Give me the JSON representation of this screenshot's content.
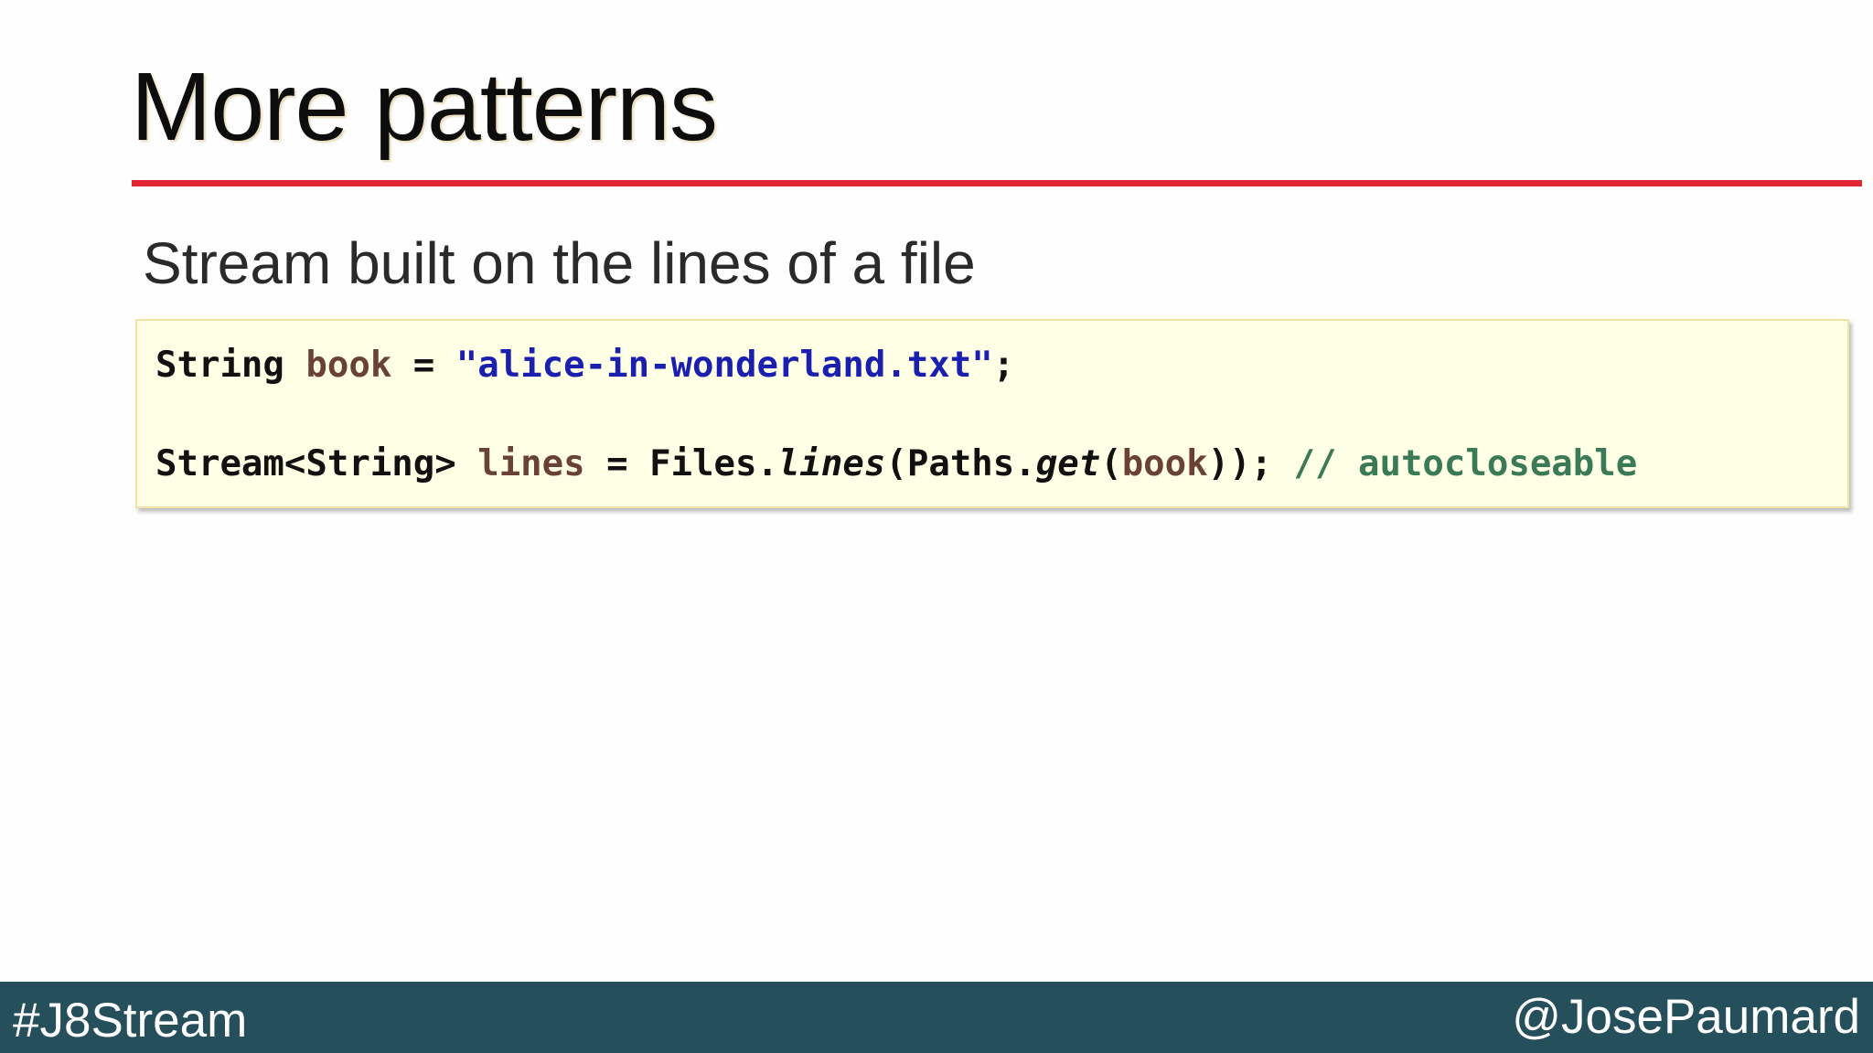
{
  "slide": {
    "title": "More patterns",
    "subtitle": "Stream built on the lines of a file"
  },
  "code": {
    "line1": {
      "type": "String",
      "var": "book",
      "eq": "=",
      "literal": "\"alice-in-wonderland.txt\"",
      "end": ";"
    },
    "line2": {
      "type": "Stream<String>",
      "var": "lines",
      "eq": "=",
      "cls1": "Files",
      "dot1": ".",
      "method1": "lines",
      "open1": "(",
      "cls2": "Paths",
      "dot2": ".",
      "method2": "get",
      "open2": "(",
      "arg": "book",
      "close": "));",
      "comment": "// autocloseable"
    }
  },
  "footer": {
    "hashtag": "#J8Stream",
    "handle": "@JosePaumard"
  },
  "colors": {
    "accent_rule": "#e32636",
    "footer_bg": "#264f5c",
    "code_bg": "#ffffe6",
    "string_literal": "#1b1fb0",
    "variable": "#6a4234",
    "comment": "#3b7a57"
  }
}
